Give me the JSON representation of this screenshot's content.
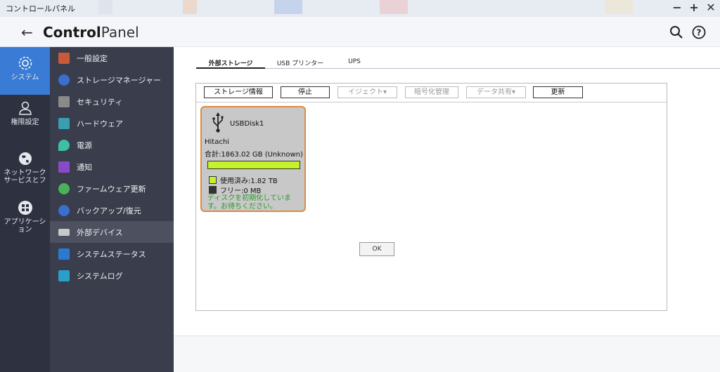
{
  "window": {
    "title": "コントロールパネル"
  },
  "header": {
    "title_bold": "Control",
    "title_light": "Panel"
  },
  "rail": {
    "items": [
      {
        "label": "システム"
      },
      {
        "label": "権限設定"
      },
      {
        "label": "ネットワーク\nサービスとフ"
      },
      {
        "label": "アプリケーシ\nョン"
      }
    ]
  },
  "submenu": {
    "items": [
      {
        "label": "一般設定",
        "color": "#c85a3a"
      },
      {
        "label": "ストレージマネージャー",
        "color": "#3a6fd0"
      },
      {
        "label": "セキュリティ",
        "color": "#8a8a8a"
      },
      {
        "label": "ハードウェア",
        "color": "#3a9fb0"
      },
      {
        "label": "電源",
        "color": "#3ec0a0"
      },
      {
        "label": "通知",
        "color": "#8a4ac8"
      },
      {
        "label": "ファームウェア更新",
        "color": "#4ab05a"
      },
      {
        "label": "バックアップ/復元",
        "color": "#3a6fd0"
      },
      {
        "label": "外部デバイス",
        "color": "#c8c8c8"
      },
      {
        "label": "システムステータス",
        "color": "#2a7ad0"
      },
      {
        "label": "システムログ",
        "color": "#2aa0c8"
      }
    ]
  },
  "tabs": [
    {
      "label": "外部ストレージ"
    },
    {
      "label": "USB プリンター"
    },
    {
      "label": "UPS"
    }
  ],
  "toolbar": {
    "storage_info": "ストレージ情報",
    "stop": "停止",
    "eject": "イジェクト▾",
    "encryption": "暗号化管理",
    "data_share": "データ共有▾",
    "refresh": "更新"
  },
  "disk": {
    "name": "USBDisk1",
    "vendor": "Hitachi",
    "total": "合計:1863.02 GB (Unknown)",
    "used_fraction": 0.999,
    "used_label": "使用済み:1.82 TB",
    "free_label": "フリー:0 MB",
    "message": "ディスクを初期化していま\nす。お待ちください。",
    "used_color": "#c6f22a",
    "free_color": "#333333",
    "border_color": "#e08a3a"
  },
  "ok_label": "OK"
}
